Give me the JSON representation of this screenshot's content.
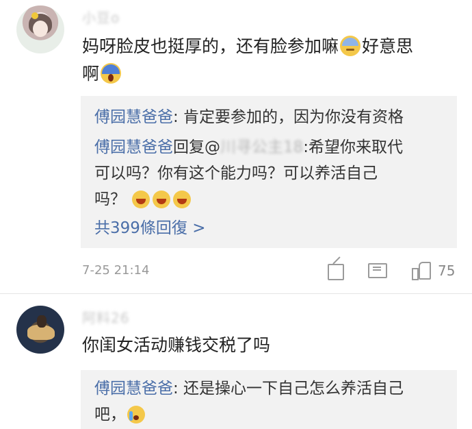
{
  "comment1": {
    "username": "小豆o",
    "text_line1": "妈呀脸皮也挺厚的，还有脸参加嘛",
    "text_line1_after_emoji": "好意思",
    "text_line2": "啊",
    "emoji_icons": [
      "sweat-emoji-icon",
      "scream-emoji-icon"
    ],
    "replies": [
      {
        "author": "傅园慧爸爸",
        "sep": ":",
        "text": " 肯定要参加的，因为你没有资格"
      },
      {
        "author": "傅园慧爸爸",
        "reply_word": "回复@",
        "mention_blurred": "川寻公主18",
        "mention_tail": ":",
        "text_line1": "希望你来取代",
        "text_line2": "可以吗？你有这个能力吗？可以养活自己",
        "text_line3": "吗？"
      }
    ],
    "more_replies": "共399條回復 >",
    "timestamp": "7-25 21:14",
    "like_count": "75"
  },
  "comment2": {
    "username": "阿料26",
    "text": "你闺女活动赚钱交税了吗",
    "replies": [
      {
        "author": "傅园慧爸爸",
        "sep": ":",
        "text_line1": " 还是操心一下自己怎么养活自己",
        "text_line2": "吧，"
      }
    ]
  },
  "colors": {
    "link_blue": "#4a6ea8",
    "reply_bg": "#f2f2f2",
    "meta_gray": "#999999"
  }
}
